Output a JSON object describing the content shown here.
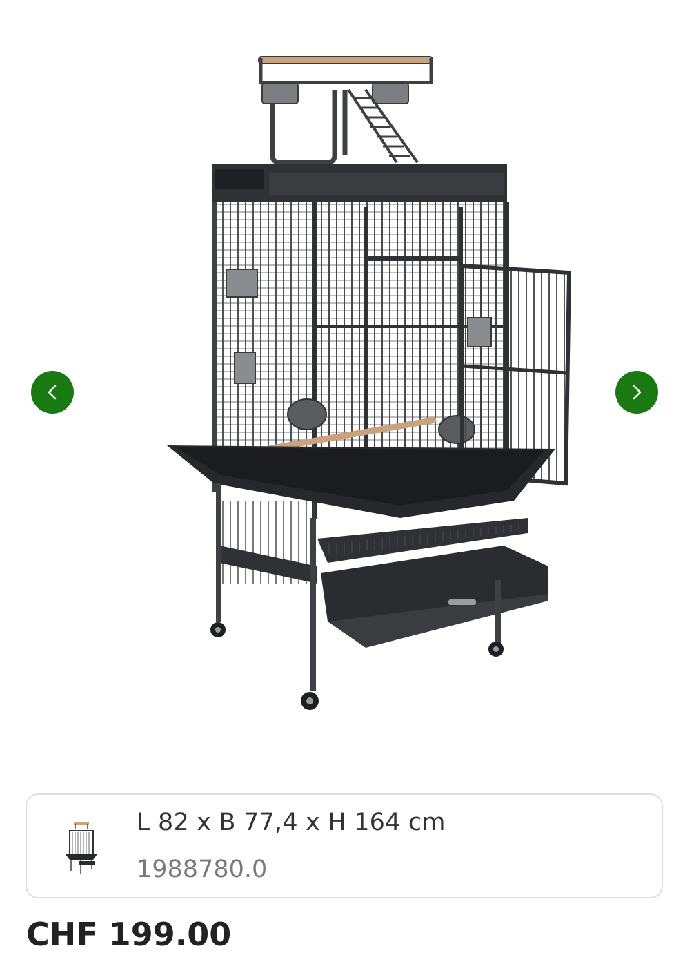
{
  "gallery": {
    "prev_icon": "chevron-left-icon",
    "next_icon": "chevron-right-icon",
    "accent_color": "#1a7a12"
  },
  "variant": {
    "dimensions": "L 82 x B 77,4 x H 164 cm",
    "article_number": "1988780.0"
  },
  "price": {
    "partial_text": "CHF 199.00"
  }
}
